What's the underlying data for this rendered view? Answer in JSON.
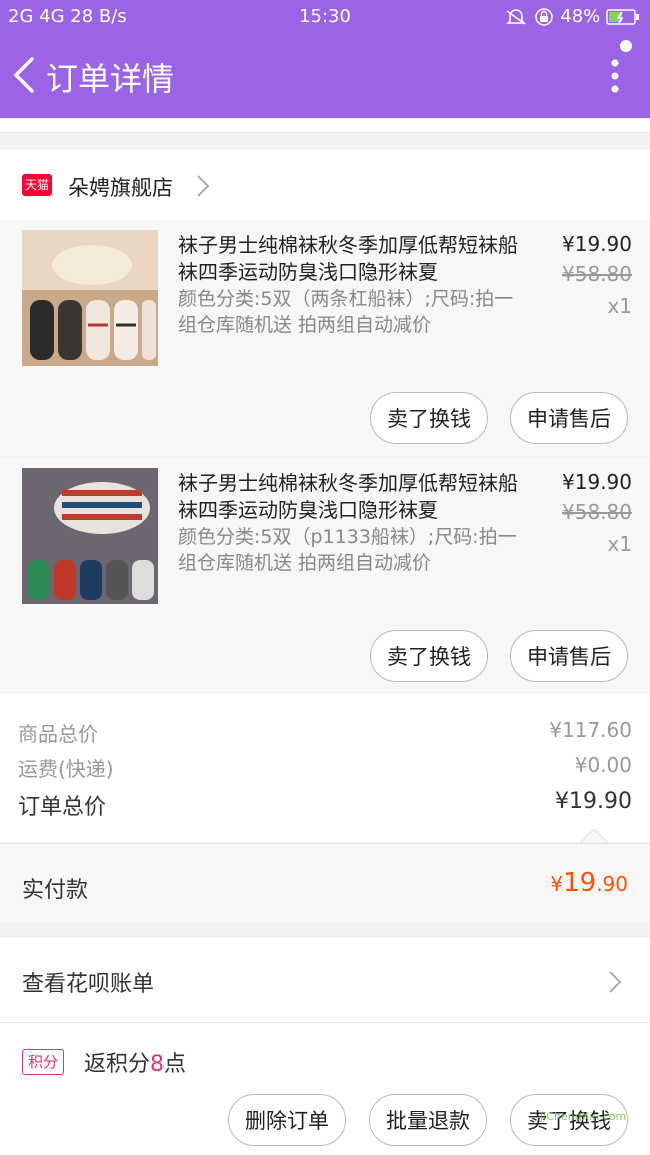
{
  "status": {
    "left": "2G 4G 28 B/s",
    "time": "15:30",
    "right": "48%"
  },
  "header": {
    "title": "订单详情"
  },
  "shop": {
    "logo_text": "天猫",
    "name": "朵娉旗舰店"
  },
  "items": [
    {
      "name": "袜子男士纯棉袜秋冬季加厚低帮短袜船袜四季运动防臭浅口隐形袜夏",
      "spec": "颜色分类:5双（两条杠船袜）;尺码:拍一组仓库随机送 拍两组自动减价",
      "price": "¥19.90",
      "orig_price": "¥58.80",
      "qty": "x1",
      "btn_resell": "卖了换钱",
      "btn_aftersale": "申请售后"
    },
    {
      "name": "袜子男士纯棉袜秋冬季加厚低帮短袜船袜四季运动防臭浅口隐形袜夏",
      "spec": "颜色分类:5双（p1133船袜）;尺码:拍一组仓库随机送 拍两组自动减价",
      "price": "¥19.90",
      "orig_price": "¥58.80",
      "qty": "x1",
      "btn_resell": "卖了换钱",
      "btn_aftersale": "申请售后"
    }
  ],
  "summary": {
    "goods_label": "商品总价",
    "goods_value": "¥117.60",
    "shipping_label": "运费(快递)",
    "shipping_value": "¥0.00",
    "order_label": "订单总价",
    "order_value": "¥19.90"
  },
  "paid": {
    "label": "实付款",
    "currency": "¥",
    "int": "19",
    "dec": ".90"
  },
  "huabei": {
    "label": "查看花呗账单"
  },
  "points": {
    "badge": "积分",
    "prefix": "返积分",
    "num": "8",
    "suffix": "点"
  },
  "bottom": {
    "delete": "删除订单",
    "batch_refund": "批量退款",
    "resell": "卖了换钱"
  },
  "watermark": "JiChengXin.com",
  "colors": {
    "header": "#9b64e6",
    "accent": "#ff5000",
    "points": "#e0356a"
  }
}
